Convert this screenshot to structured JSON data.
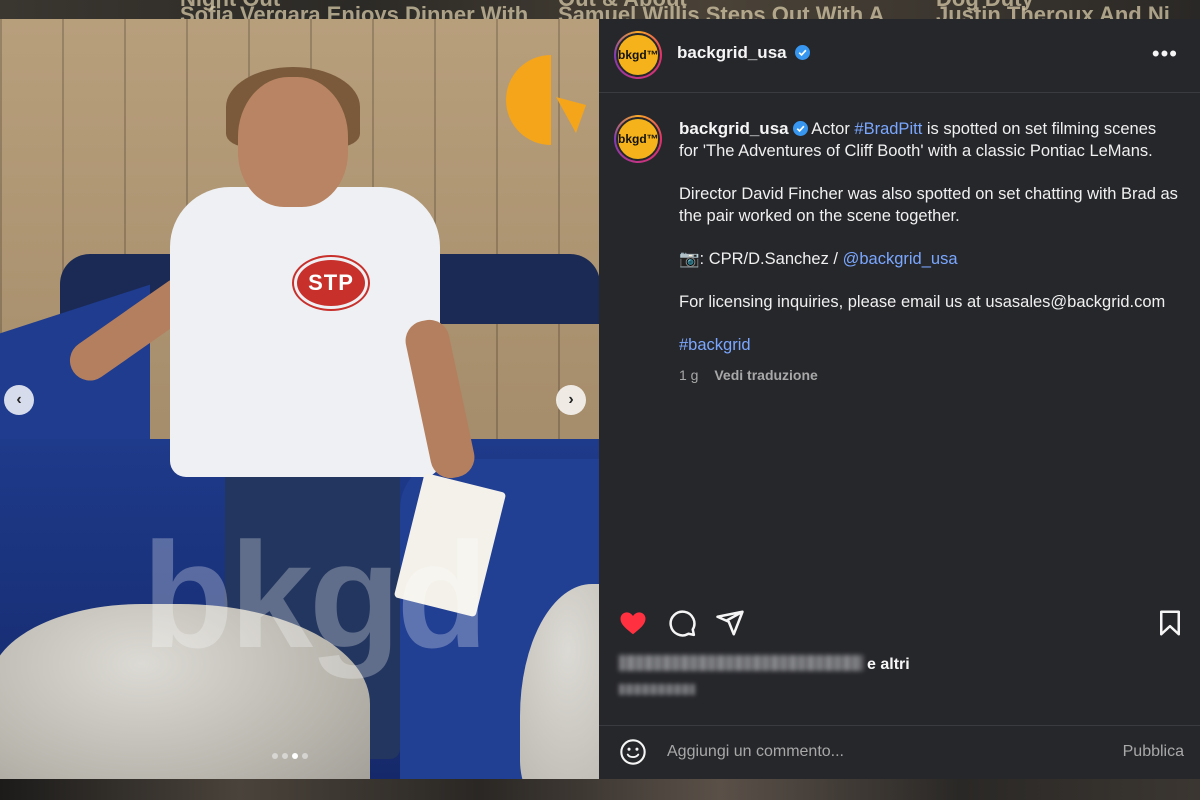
{
  "background": {
    "headlines": [
      "Night Out",
      "Sofia Vergara Enjoys Dinner With",
      "Out & About",
      "Samuel Willis Steps Out With A",
      "Dog Duty",
      "Justin Theroux And Ni"
    ]
  },
  "media": {
    "watermark": "bkgd",
    "shirt_logo": "STP",
    "slide_count": 4,
    "active_slide": 3,
    "prev_icon": "chevron-left-icon",
    "next_icon": "chevron-right-icon"
  },
  "post": {
    "account": "backgrid_usa",
    "avatar_text": "bkgd™",
    "verified": true,
    "more_icon": "more-horizontal-icon",
    "caption": {
      "intro": "Actor",
      "hashtag_person": "#BradPitt",
      "line1_rest": "is spotted on set filming scenes for 'The Adventures of Cliff Booth' with a classic Pontiac LeMans.",
      "para2": "Director David Fincher was also spotted on set chatting with Brad as the pair worked on the scene together.",
      "credit_prefix": "📷: CPR/D.Sanchez /",
      "credit_handle": "@backgrid_usa",
      "para4": "For licensing inquiries, please email us at usasales@backgrid.com",
      "hashtag": "#backgrid",
      "time": "1 g",
      "translate": "Vedi traduzione"
    },
    "likes_suffix": "e altri",
    "liked": true,
    "comment_placeholder": "Aggiungi un commento...",
    "publish_label": "Pubblica"
  },
  "colors": {
    "panel_bg": "#26272b",
    "link": "#7aa7ff",
    "like_red": "#ff3040",
    "verified_blue": "#3797f0",
    "brand_yellow": "#f5b21a"
  }
}
